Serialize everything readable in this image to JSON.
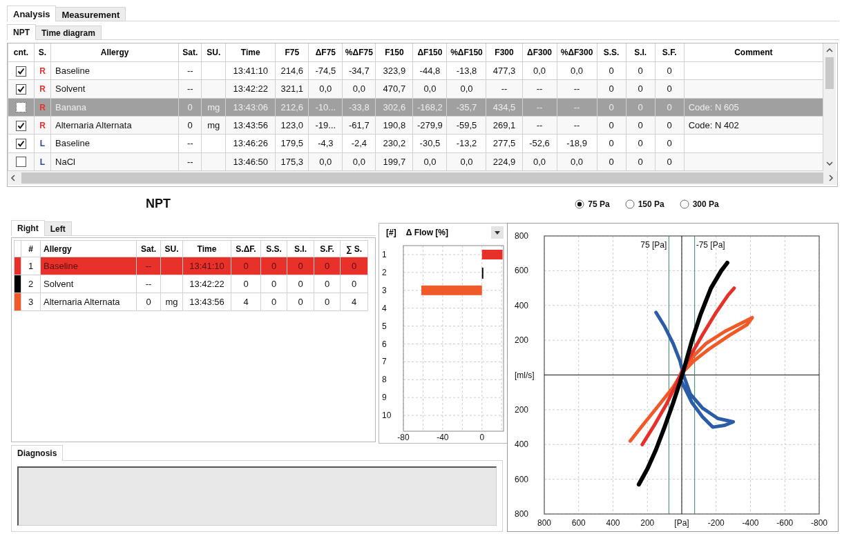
{
  "tabs": [
    {
      "label": "Analysis",
      "selected": true
    },
    {
      "label": "Measurement",
      "selected": false
    }
  ],
  "subtabs": [
    {
      "label": "NPT",
      "selected": true
    },
    {
      "label": "Time diagram",
      "selected": false
    }
  ],
  "measurements": {
    "columns": [
      "cnt.",
      "S.",
      "Allergy",
      "Sat.",
      "SU.",
      "Time",
      "F75",
      "ΔF75",
      "%ΔF75",
      "F150",
      "ΔF150",
      "%ΔF150",
      "F300",
      "ΔF300",
      "%ΔF300",
      "S.S.",
      "S.I.",
      "S.F.",
      "Comment"
    ],
    "rows": [
      {
        "checked": true,
        "selected": false,
        "color": "#e8302a",
        "cells": [
          "",
          "R",
          "Baseline",
          "--",
          "",
          "13:41:10",
          "214,6",
          "-74,5",
          "-34,7",
          "323,9",
          "-44,8",
          "-13,8",
          "477,3",
          "0,0",
          "0,0",
          "0",
          "0",
          "0",
          ""
        ]
      },
      {
        "checked": true,
        "selected": false,
        "color": "#e8302a",
        "cells": [
          "",
          "R",
          "Solvent",
          "--",
          "",
          "13:42:22",
          "321,1",
          "0,0",
          "0,0",
          "470,7",
          "0,0",
          "0,0",
          "--",
          "--",
          "--",
          "0",
          "0",
          "0",
          ""
        ]
      },
      {
        "checked": false,
        "selected": true,
        "color": "#e8302a",
        "cells": [
          "",
          "R",
          "Banana",
          "0",
          "mg",
          "13:43:06",
          "212,6",
          "-10...",
          "-33,8",
          "302,6",
          "-168,2",
          "-35,7",
          "434,5",
          "--",
          "--",
          "0",
          "0",
          "0",
          "Code: N 605"
        ]
      },
      {
        "checked": true,
        "selected": false,
        "color": "#e8302a",
        "cells": [
          "",
          "R",
          "Alternaria Alternata",
          "0",
          "mg",
          "13:43:56",
          "123,0",
          "-19...",
          "-61,7",
          "190,8",
          "-279,9",
          "-59,5",
          "269,1",
          "--",
          "--",
          "0",
          "0",
          "0",
          "Code: N 402"
        ]
      },
      {
        "checked": true,
        "selected": false,
        "color": "#2b4a9a",
        "cells": [
          "",
          "L",
          "Baseline",
          "--",
          "",
          "13:46:26",
          "179,5",
          "-4,3",
          "-2,4",
          "230,2",
          "-30,5",
          "-13,2",
          "277,5",
          "-52,6",
          "-18,9",
          "0",
          "0",
          "0",
          ""
        ]
      },
      {
        "checked": false,
        "selected": false,
        "color": "#2b4a9a",
        "cells": [
          "",
          "L",
          "NaCl",
          "--",
          "",
          "13:46:50",
          "175,3",
          "0,0",
          "0,0",
          "199,7",
          "0,0",
          "0,0",
          "224,9",
          "0,0",
          "0,0",
          "0",
          "0",
          "0",
          ""
        ]
      }
    ]
  },
  "title": "NPT",
  "pressures": [
    {
      "label": "75 Pa",
      "selected": true
    },
    {
      "label": "150 Pa",
      "selected": false
    },
    {
      "label": "300 Pa",
      "selected": false
    }
  ],
  "side_tabs": [
    {
      "label": "Right",
      "selected": true
    },
    {
      "label": "Left",
      "selected": false
    }
  ],
  "scores": {
    "columns": [
      "#",
      "Allergy",
      "Sat.",
      "SU.",
      "Time",
      "S.ΔF.",
      "S.S.",
      "S.I.",
      "S.F.",
      "∑ S."
    ],
    "rows": [
      {
        "color": "#e8302a",
        "selected": true,
        "cells": [
          "1",
          "Baseline",
          "--",
          "",
          "13:41:10",
          "0",
          "0",
          "0",
          "0",
          "0"
        ]
      },
      {
        "color": "#000000",
        "selected": false,
        "cells": [
          "2",
          "Solvent",
          "--",
          "",
          "13:42:22",
          "0",
          "0",
          "0",
          "0",
          "0"
        ]
      },
      {
        "color": "#f05a28",
        "selected": false,
        "cells": [
          "3",
          "Alternaria Alternata",
          "0",
          "mg",
          "13:43:56",
          "4",
          "0",
          "0",
          "0",
          "4"
        ]
      }
    ]
  },
  "flow_chart": {
    "row_header": "[#]",
    "measure": "Δ Flow [%]",
    "chart_data": {
      "type": "bar",
      "orientation": "horizontal",
      "categories": [
        "1",
        "2",
        "3",
        "4",
        "5",
        "6",
        "7",
        "8",
        "9",
        "10"
      ],
      "xlim": [
        -80,
        22
      ],
      "xticks": [
        -80,
        -40,
        0
      ],
      "grid": true,
      "series": [
        {
          "color": "#e8302a",
          "values": [
            21,
            null,
            null,
            null,
            null,
            null,
            null,
            null,
            null,
            null
          ]
        },
        {
          "color": "#000000",
          "values": [
            null,
            0.5,
            null,
            null,
            null,
            null,
            null,
            null,
            null,
            null
          ]
        },
        {
          "color": "#f05a28",
          "values": [
            null,
            null,
            -61.7,
            null,
            null,
            null,
            null,
            null,
            null,
            null
          ]
        }
      ]
    }
  },
  "loop_chart": {
    "chart_data": {
      "type": "line",
      "xlim": [
        800,
        -800
      ],
      "ylim": [
        -800,
        800
      ],
      "xticks": [
        800,
        600,
        400,
        200,
        {
          "value": 0,
          "label": "[Pa]"
        },
        -200,
        -400,
        -600,
        -800
      ],
      "yticks": [
        {
          "value": 800,
          "label": "800"
        },
        {
          "value": 600,
          "label": "600"
        },
        {
          "value": 400,
          "label": "400"
        },
        {
          "value": 200,
          "label": "200"
        },
        {
          "value": 0,
          "label": "[ml/s]"
        },
        {
          "value": -200,
          "label": "200"
        },
        {
          "value": -400,
          "label": "400"
        },
        {
          "value": -600,
          "label": "600"
        },
        {
          "value": -800,
          "label": "800"
        }
      ],
      "grid": true,
      "ref_lines": [
        {
          "axis": "x",
          "value": 75,
          "label": "75 [Pa]",
          "color": "#2a8a6a"
        },
        {
          "axis": "x",
          "value": -75,
          "label": "-75 [Pa]",
          "color": "#2a8a6a"
        }
      ],
      "series": [
        {
          "color": "#2b5ca8",
          "x": [
            150,
            100,
            50,
            10,
            -10,
            -50,
            -120,
            -210,
            -300,
            -250,
            -180,
            -120,
            -60,
            0
          ],
          "values": [
            360,
            280,
            180,
            80,
            0,
            -110,
            -190,
            -250,
            -270,
            -290,
            -300,
            -240,
            -160,
            -40
          ]
        },
        {
          "color": "#f05a28",
          "x": [
            300,
            220,
            130,
            50,
            0,
            -60,
            -140,
            -250,
            -350,
            -410,
            -380,
            -280,
            -160,
            -70,
            -10
          ],
          "values": [
            -380,
            -280,
            -170,
            -70,
            10,
            100,
            180,
            250,
            300,
            330,
            290,
            230,
            150,
            80,
            20
          ]
        },
        {
          "color": "#e8302a",
          "x": [
            230,
            160,
            90,
            30,
            0,
            -50,
            -120,
            -200,
            -270,
            -305
          ],
          "values": [
            -400,
            -290,
            -170,
            -50,
            20,
            110,
            230,
            360,
            460,
            500
          ]
        },
        {
          "color": "#000000",
          "x": [
            250,
            200,
            150,
            100,
            50,
            10,
            -20,
            -60,
            -110,
            -170,
            -230,
            -265
          ],
          "values": [
            -630,
            -540,
            -430,
            -300,
            -160,
            -40,
            60,
            200,
            350,
            500,
            600,
            645
          ]
        }
      ]
    }
  },
  "diagnosis": {
    "tab": "Diagnosis"
  }
}
